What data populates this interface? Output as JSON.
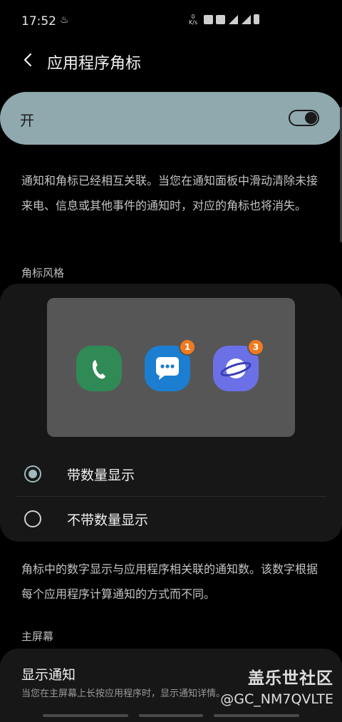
{
  "status_bar": {
    "time": "17:52",
    "net_speed_value": "0",
    "net_speed_unit": "K/s",
    "icons": [
      "alarm-icon",
      "mute-icon",
      "4g-signal-icon",
      "4g-signal-icon",
      "battery-icon"
    ]
  },
  "header": {
    "title": "应用程序角标",
    "back_icon": "chevron-left-icon"
  },
  "master_switch": {
    "label": "开",
    "on": true
  },
  "description": "通知和角标已经相互关联。当您在通知面板中滑动清除未接来电、信息或其他事件的通知时，对应的角标也将消失。",
  "badge_style": {
    "section_title": "角标风格",
    "preview_apps": [
      {
        "name": "phone-app-icon",
        "color": "#2f8a55",
        "badge": ""
      },
      {
        "name": "messages-app-icon",
        "color": "#1b7ed0",
        "badge": "1"
      },
      {
        "name": "internet-app-icon",
        "color": "#6c70e6",
        "badge": "3"
      }
    ],
    "options": [
      {
        "label": "带数量显示",
        "selected": true
      },
      {
        "label": "不带数量显示",
        "selected": false
      }
    ]
  },
  "badge_note": "角标中的数字显示与应用程序相关联的通知数。该数字根据每个应用程序计算通知的方式而不同。",
  "home_screen": {
    "section_title": "主屏幕",
    "show_notifications_title": "显示通知",
    "show_notifications_sub": "当您在主屏幕上长按应用程序时，显示通知详情。"
  },
  "watermark": {
    "logo": "盖乐世社区",
    "user": "@GC_NM7QVLTE"
  },
  "colors": {
    "accent": "#8fa9ae",
    "card": "#171717",
    "badge": "#f07a1e"
  }
}
